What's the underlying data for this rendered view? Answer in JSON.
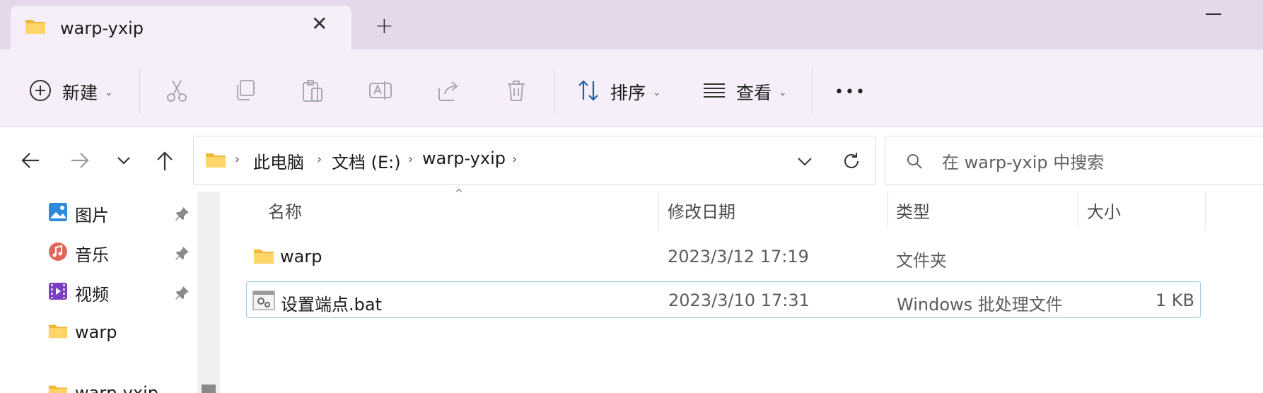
{
  "window": {
    "tab_title": "warp-yxip",
    "close_tab_glyph": "✕",
    "new_tab_glyph": "+",
    "accent": "#e5d8eb"
  },
  "toolbar": {
    "new_label": "新建",
    "sort_label": "排序",
    "view_label": "查看",
    "more_glyph": "•••",
    "chevron": "⌄",
    "icons": [
      "cut-icon",
      "copy-icon",
      "paste-icon",
      "rename-icon",
      "share-icon",
      "delete-icon"
    ]
  },
  "address": {
    "crumbs": [
      "此电脑",
      "文档 (E:)",
      "warp-yxip"
    ],
    "separator": "›"
  },
  "search": {
    "placeholder": "在 warp-yxip 中搜索"
  },
  "sidebar": {
    "items": [
      {
        "label": "图片",
        "icon": "pictures-icon",
        "pinned": true
      },
      {
        "label": "音乐",
        "icon": "music-icon",
        "pinned": true
      },
      {
        "label": "视频",
        "icon": "videos-icon",
        "pinned": true
      },
      {
        "label": "warp",
        "icon": "folder-icon",
        "pinned": false
      },
      {
        "label": "warp-yxip",
        "icon": "folder-icon",
        "pinned": false
      }
    ]
  },
  "columns": {
    "name": "名称",
    "date": "修改日期",
    "type": "类型",
    "size": "大小",
    "sort_glyph": "^"
  },
  "files": [
    {
      "name": "warp",
      "date": "2023/3/12 17:19",
      "type": "文件夹",
      "size": "",
      "icon": "folder-icon"
    },
    {
      "name": "设置端点.bat",
      "date": "2023/3/10 17:31",
      "type": "Windows 批处理文件",
      "size": "1 KB",
      "icon": "batch-file-icon"
    }
  ]
}
